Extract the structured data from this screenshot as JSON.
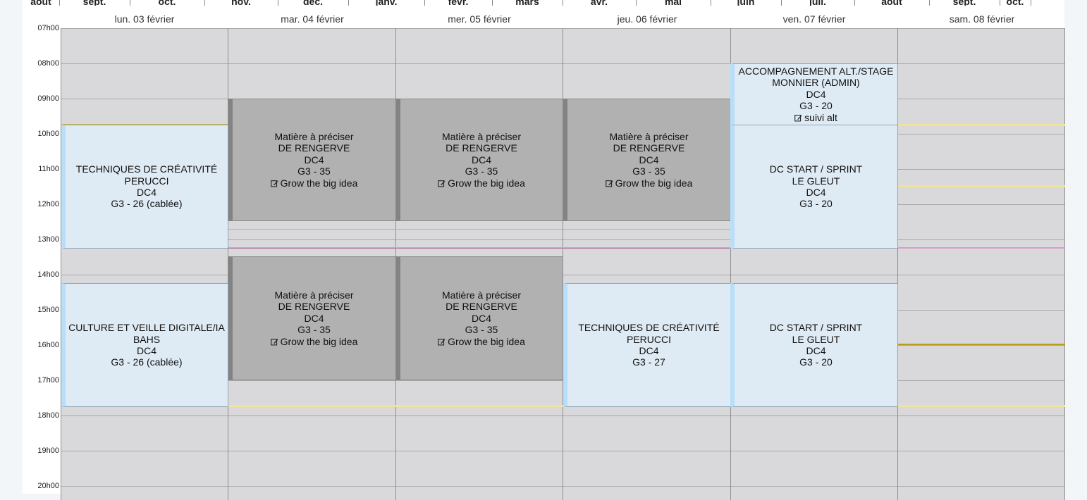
{
  "months": [
    "août",
    "sept.",
    "oct.",
    "nov.",
    "déc.",
    "janv.",
    "févr.",
    "mars",
    "avr.",
    "mai",
    "juin",
    "juil.",
    "août",
    "sept.",
    "oct."
  ],
  "days": [
    "lun. 03 février",
    "mar. 04 février",
    "mer. 05 février",
    "jeu. 06 février",
    "ven. 07 février",
    "sam. 08 février"
  ],
  "hours": [
    "07h00",
    "08h00",
    "09h00",
    "10h00",
    "11h00",
    "12h00",
    "13h00",
    "14h00",
    "15h00",
    "16h00",
    "17h00",
    "18h00",
    "19h00",
    "20h00"
  ],
  "events": [
    {
      "id": "mon-am",
      "style": "blue",
      "day": 0,
      "lines": [
        "TECHNIQUES DE CRÉATIVITÉ",
        "PERUCCI",
        "DC4",
        "G3 - 26 (cablée)"
      ],
      "note": ""
    },
    {
      "id": "mon-pm",
      "style": "blue",
      "day": 0,
      "lines": [
        "CULTURE ET VEILLE DIGITALE/IA",
        "BAHS",
        "DC4",
        "G3 - 26 (cablée)"
      ],
      "note": ""
    },
    {
      "id": "tue-am",
      "style": "gray",
      "day": 1,
      "lines": [
        "Matière à préciser",
        "DE RENGERVE",
        "DC4",
        "G3 - 35"
      ],
      "note": "Grow the big idea"
    },
    {
      "id": "tue-pm",
      "style": "gray",
      "day": 1,
      "lines": [
        "Matière à préciser",
        "DE RENGERVE",
        "DC4",
        "G3 - 35"
      ],
      "note": "Grow the big idea"
    },
    {
      "id": "wed-am",
      "style": "gray",
      "day": 2,
      "lines": [
        "Matière à préciser",
        "DE RENGERVE",
        "DC4",
        "G3 - 35"
      ],
      "note": "Grow the big idea"
    },
    {
      "id": "wed-pm",
      "style": "gray",
      "day": 2,
      "lines": [
        "Matière à préciser",
        "DE RENGERVE",
        "DC4",
        "G3 - 35"
      ],
      "note": "Grow the big idea"
    },
    {
      "id": "thu-am",
      "style": "gray",
      "day": 3,
      "lines": [
        "Matière à préciser",
        "DE RENGERVE",
        "DC4",
        "G3 - 35"
      ],
      "note": "Grow the big idea"
    },
    {
      "id": "thu-pm",
      "style": "blue",
      "day": 3,
      "lines": [
        "TECHNIQUES DE CRÉATIVITÉ",
        "PERUCCI",
        "DC4",
        "G3 - 27"
      ],
      "note": ""
    },
    {
      "id": "fri-early",
      "style": "blue",
      "day": 4,
      "lines": [
        "ACCOMPAGNEMENT ALT./STAGE",
        "MONNIER (ADMIN)",
        "DC4",
        "G3 - 20"
      ],
      "note": "suivi alt"
    },
    {
      "id": "fri-am",
      "style": "blue",
      "day": 4,
      "lines": [
        "DC START / SPRINT",
        "LE GLEUT",
        "DC4",
        "G3 - 20"
      ],
      "note": ""
    },
    {
      "id": "fri-pm",
      "style": "blue",
      "day": 4,
      "lines": [
        "DC START / SPRINT",
        "LE GLEUT",
        "DC4",
        "G3 - 20"
      ],
      "note": ""
    }
  ],
  "icons": {
    "note": "edit-note-icon"
  }
}
